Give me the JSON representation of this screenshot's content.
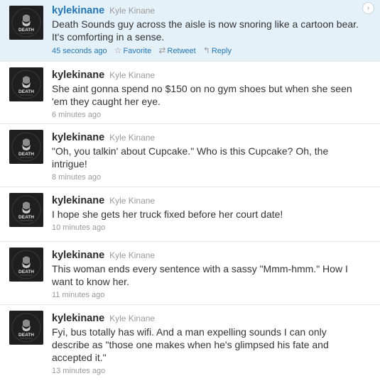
{
  "tweets": [
    {
      "screen_name": "kylekinane",
      "full_name": "Kyle Kinane",
      "text": "Death Sounds guy across the aisle is now snoring like a cartoon bear. It's comforting in a sense.",
      "time": "45 seconds ago",
      "favorite_label": "Favorite",
      "retweet_label": "Retweet",
      "reply_label": "Reply"
    },
    {
      "screen_name": "kylekinane",
      "full_name": "Kyle Kinane",
      "text": "She aint gonna spend no $150 on no gym shoes but when she seen 'em they caught her eye.",
      "time": "6 minutes ago"
    },
    {
      "screen_name": "kylekinane",
      "full_name": "Kyle Kinane",
      "text": "\"Oh, you talkin' about Cupcake.\" Who is this Cupcake? Oh, the intrigue!",
      "time": "8 minutes ago"
    },
    {
      "screen_name": "kylekinane",
      "full_name": "Kyle Kinane",
      "text": "I hope she gets her truck fixed before her court date!",
      "time": "10 minutes ago"
    },
    {
      "screen_name": "kylekinane",
      "full_name": "Kyle Kinane",
      "text": "This woman ends every sentence with a sassy \"Mmm-hmm.\" How I want to know her.",
      "time": "11 minutes ago"
    },
    {
      "screen_name": "kylekinane",
      "full_name": "Kyle Kinane",
      "text": "Fyi, bus totally has wifi. And a man expelling sounds I can only describe as \"those one makes when he's glimpsed his fate and accepted it.\"",
      "time": "13 minutes ago"
    }
  ],
  "avatar_text": "DEATH",
  "icons": {
    "details": "chevron-right-icon",
    "favorite": "star-icon",
    "retweet": "retweet-icon",
    "reply": "reply-icon"
  },
  "colors": {
    "highlight_background": "#e5f1f8",
    "link": "#2276bb",
    "screen_name": "#2b2b2b",
    "muted": "#9a9a9a"
  }
}
